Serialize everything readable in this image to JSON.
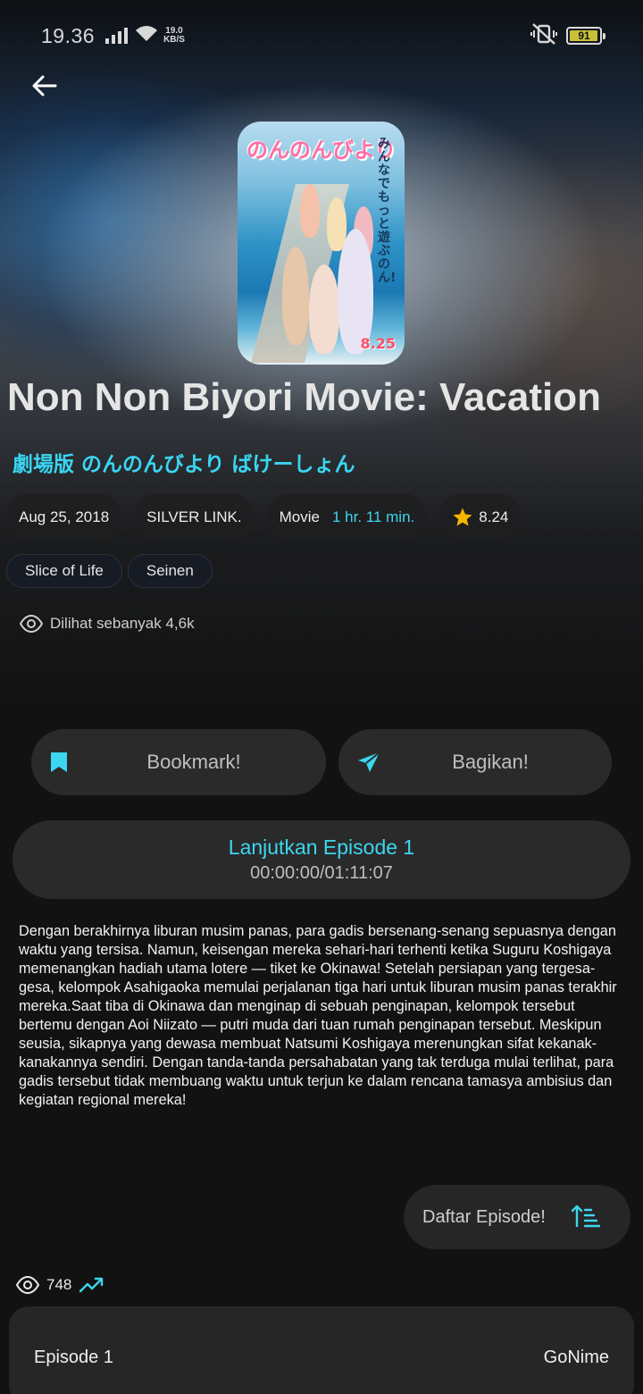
{
  "status_bar": {
    "time": "19.36",
    "net_speed_value": "19.0",
    "net_speed_unit": "KB/S",
    "battery": "91"
  },
  "anime": {
    "title": "Non Non Biyori Movie: Vacation",
    "alt_title": "劇場版 のんのんびより ばけーしょん",
    "release_date": "Aug 25, 2018",
    "studio": "SILVER LINK.",
    "type": "Movie",
    "duration": "1 hr. 11 min.",
    "score": "8.24",
    "genres": [
      "Slice of Life",
      "Seinen"
    ],
    "views_text": "Dilihat sebanyak 4,6k",
    "synopsis": "Dengan berakhirnya liburan musim panas, para gadis bersenang-senang sepuasnya dengan waktu yang tersisa. Namun, keisengan mereka sehari-hari terhenti ketika Suguru Koshigaya memenangkan hadiah utama lotere — tiket ke Okinawa! Setelah persiapan yang tergesa-gesa, kelompok Asahigaoka memulai perjalanan tiga hari untuk liburan musim panas terakhir mereka.Saat tiba di Okinawa dan menginap di sebuah penginapan, kelompok tersebut bertemu dengan Aoi Niizato — putri muda dari tuan rumah penginapan tersebut. Meskipun seusia, sikapnya yang dewasa membuat Natsumi Koshigaya merenungkan sifat kekanak-kanakannya sendiri. Dengan tanda-tanda persahabatan yang tak terduga mulai terlihat, para gadis tersebut tidak membuang waktu untuk terjun ke dalam rencana tamasya ambisius dan kegiatan regional mereka!"
  },
  "poster": {
    "logo_text": "のんのんびより",
    "tagline": "みんなでもっと遊ぶのん!",
    "date_text": "8.25"
  },
  "actions": {
    "bookmark_label": "Bookmark!",
    "share_label": "Bagikan!"
  },
  "continue": {
    "label": "Lanjutkan Episode 1",
    "progress": "00:00:00/01:11:07"
  },
  "episodes": {
    "list_button_label": "Daftar Episode!",
    "views_count": "748",
    "items": [
      {
        "title": "Episode 1",
        "source": "GoNime"
      }
    ]
  },
  "colors": {
    "accent": "#3cd6f0",
    "background": "#121212",
    "card": "#2a2a2a",
    "star": "#f5b400"
  }
}
